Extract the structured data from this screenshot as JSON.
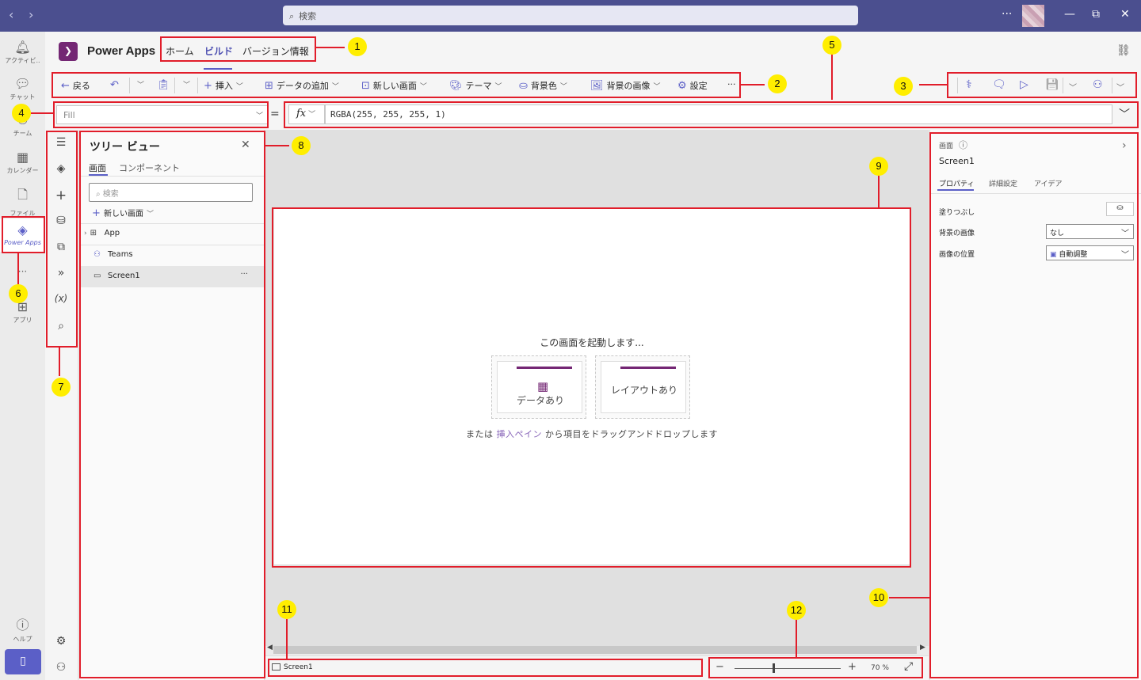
{
  "titlebar": {
    "search_placeholder": "検索",
    "more_label": "···",
    "minimize_label": "—",
    "restore_label": "⧉",
    "close_label": "✕"
  },
  "teams_rail": {
    "items": [
      {
        "label": "アクティビ..",
        "icon": "bell-icon"
      },
      {
        "label": "チャット",
        "icon": "chat-icon"
      },
      {
        "label": "チーム",
        "icon": "teams-icon"
      },
      {
        "label": "カレンダー",
        "icon": "calendar-icon"
      },
      {
        "label": "ファイル",
        "icon": "file-icon"
      },
      {
        "label": "Power Apps",
        "icon": "powerapps-icon"
      },
      {
        "label": "···",
        "icon": "more-icon"
      },
      {
        "label": "アプリ",
        "icon": "apps-icon"
      },
      {
        "label": "ヘルプ",
        "icon": "help-icon"
      }
    ]
  },
  "app_header": {
    "title": "Power Apps",
    "tabs": [
      "ホーム",
      "ビルド",
      "バージョン情報"
    ],
    "active_tab": "ビルド"
  },
  "command_bar": {
    "back": "戻る",
    "insert": "挿入",
    "add_data": "データの追加",
    "new_screen": "新しい画面",
    "theme": "テーマ",
    "background_color": "背景色",
    "background_image": "背景の画像",
    "settings": "設定",
    "more": "···"
  },
  "formula_bar": {
    "property": "Fill",
    "equals": "=",
    "fx_label": "fx",
    "formula": "RGBA(255, 255, 255, 1)"
  },
  "tree_view": {
    "title": "ツリー ビュー",
    "tabs": [
      "画面",
      "コンポーネント"
    ],
    "search_placeholder": "検索",
    "new_screen": "新しい画面",
    "items": [
      {
        "label": "App",
        "icon": "app-icon"
      },
      {
        "label": "Teams",
        "icon": "teams-icon"
      },
      {
        "label": "Screen1",
        "icon": "screen-icon",
        "selected": true
      }
    ],
    "more": "···"
  },
  "canvas": {
    "heading": "この画面を起動します...",
    "cards": [
      "データあり",
      "レイアウトあり"
    ],
    "hint_prefix": "または",
    "hint_link": "挿入ペイン",
    "hint_suffix": "から項目をドラッグアンドドロップします"
  },
  "status_bar": {
    "screen": "Screen1",
    "zoom_value": "70",
    "zoom_unit": "%",
    "zoom_level": 0.7
  },
  "properties_panel": {
    "type": "画面",
    "name": "Screen1",
    "tabs": [
      "プロパティ",
      "詳細設定",
      "アイデア"
    ],
    "fill_label": "塗りつぶし",
    "bg_image_label": "背景の画像",
    "bg_image_value": "なし",
    "image_position_label": "画像の位置",
    "image_position_value": "自動調整"
  },
  "annotations": [
    "1",
    "2",
    "3",
    "4",
    "5",
    "6",
    "7",
    "8",
    "9",
    "10",
    "11",
    "12"
  ],
  "colors": {
    "teams_purple": "#4b4f8f",
    "accent": "#5b5fc7",
    "powerapps_brand": "#742774",
    "annotation_red": "#e11d2a",
    "annotation_badge": "#ffee00"
  }
}
